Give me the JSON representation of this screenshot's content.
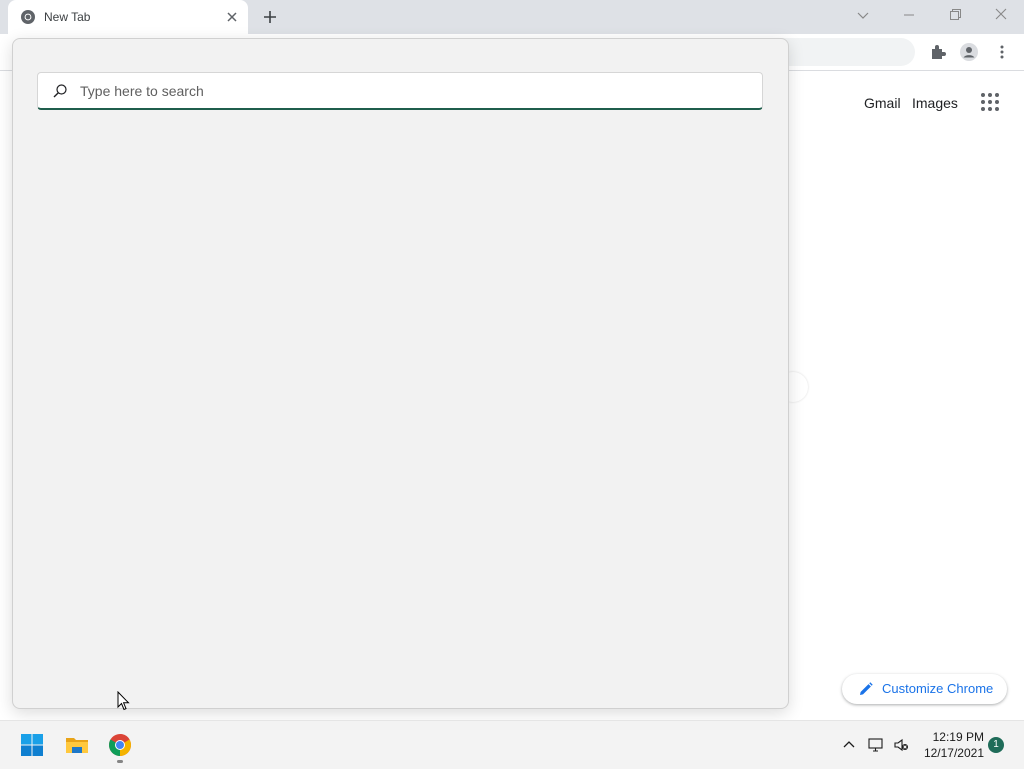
{
  "browser": {
    "tab": {
      "title": "New Tab",
      "favicon": "chrome-icon"
    },
    "colors": {
      "titlebar": "#dee1e6",
      "toolbar": "#ffffff"
    }
  },
  "ntp": {
    "links": {
      "gmail": "Gmail",
      "images": "Images"
    },
    "customize_label": "Customize Chrome",
    "accent": "#1a73e8"
  },
  "search_panel": {
    "placeholder": "Type here to search",
    "accent": "#1f5e4c"
  },
  "taskbar": {
    "apps": [
      "start-icon",
      "file-explorer-icon",
      "chrome-icon"
    ],
    "tray": {
      "time": "12:19 PM",
      "date": "12/17/2021",
      "notification_count": "1"
    }
  }
}
